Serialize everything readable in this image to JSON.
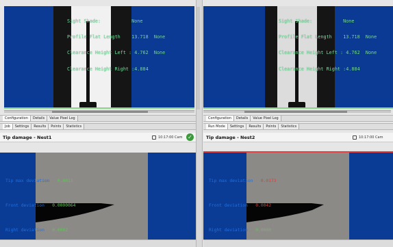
{
  "top_left": {
    "overlay": [
      "Sight Shade:           None",
      "Profile Flat Length    13.718  None",
      "Clearance Height Left : 4.762  None",
      "Clearance Height Right :4.884"
    ]
  },
  "top_right": {
    "overlay": [
      "Sight Shade:           None",
      "Profile Flat Length    13.718  None",
      "Clearance Height Left : 4.762  None",
      "Clearance Height Right :4.884"
    ]
  },
  "left_panel": {
    "tabs_top": [
      "Configuration",
      "Details",
      "Value Pixel Log"
    ],
    "tabs": [
      "Job",
      "Settings",
      "Results",
      "Points",
      "Statistics"
    ],
    "title": "Tip damage - Nest1",
    "time": "10:17:00 Cam",
    "status": "ok",
    "measurements": [
      {
        "label": "Tip max deviation",
        "value": "0.0013"
      },
      {
        "label": "Front deviation",
        "value": "0.0000064"
      },
      {
        "label": "Right deviation",
        "value": "0.0002"
      }
    ]
  },
  "right_panel": {
    "tabs_top": [
      "Configuration",
      "Details",
      "Value Pixel Log"
    ],
    "tabs": [
      "Run Mode",
      "Settings",
      "Results",
      "Points",
      "Statistics"
    ],
    "title": "Tip damage - Nest2",
    "time": "10:17:00 Cam",
    "measurements": [
      {
        "label": "Tip max deviation",
        "value": "0.0173"
      },
      {
        "label": "Front deviation",
        "value": "0.0042"
      },
      {
        "label": "Right deviation",
        "value": "0.0000"
      }
    ]
  },
  "colors": {
    "view_background": "#0a3a93",
    "ok_green": "#3c9a3c",
    "fail_red": "#e04444"
  },
  "icons": [
    "checkmark-circle-icon",
    "pin-icon"
  ]
}
